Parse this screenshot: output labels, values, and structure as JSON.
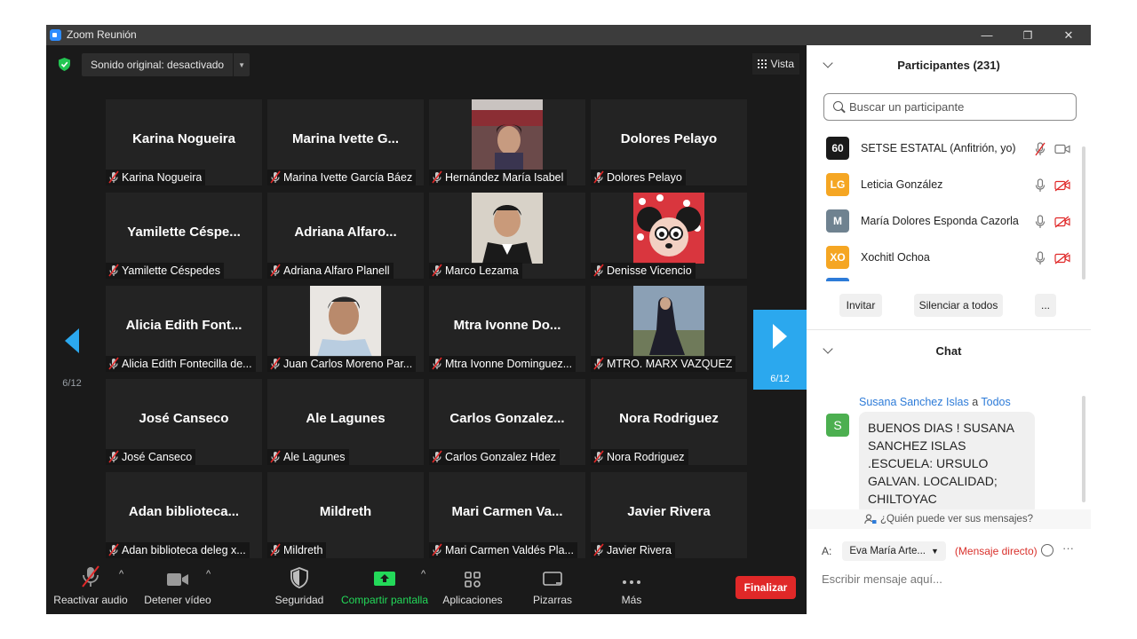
{
  "window": {
    "title": "Zoom Reunión",
    "minimize": "—",
    "restore": "❐",
    "close": "✕"
  },
  "top": {
    "audio_label": "Sonido original: desactivado",
    "view_label": "Vista"
  },
  "paging": {
    "prev_label": "6/12",
    "next_label": "6/12"
  },
  "tiles": [
    {
      "big": "Karina Nogueira",
      "name": "Karina Nogueira",
      "photo": ""
    },
    {
      "big": "Marina Ivette G...",
      "name": "Marina Ivette García Báez",
      "photo": ""
    },
    {
      "big": "",
      "name": "Hernández María Isabel",
      "photo": "woman"
    },
    {
      "big": "Dolores Pelayo",
      "name": "Dolores Pelayo",
      "photo": ""
    },
    {
      "big": "Yamilette  Céspe...",
      "name": "Yamilette Céspedes",
      "photo": ""
    },
    {
      "big": "Adriana  Alfaro...",
      "name": "Adriana Alfaro Planell",
      "photo": ""
    },
    {
      "big": "",
      "name": "Marco Lezama",
      "photo": "man"
    },
    {
      "big": "",
      "name": "Denisse Vicencio",
      "photo": "minnie"
    },
    {
      "big": "Alicia Edith  Font...",
      "name": "Alicia Edith Fontecilla de...",
      "photo": ""
    },
    {
      "big": "",
      "name": "Juan Carlos Moreno Par...",
      "photo": "man2"
    },
    {
      "big": "Mtra  Ivonne  Do...",
      "name": "Mtra Ivonne Dominguez...",
      "photo": ""
    },
    {
      "big": "",
      "name": "MTRO. MARX VAZQUEZ",
      "photo": "dark"
    },
    {
      "big": "José Canseco",
      "name": "José Canseco",
      "photo": ""
    },
    {
      "big": "Ale Lagunes",
      "name": "Ale Lagunes",
      "photo": ""
    },
    {
      "big": "Carlos  Gonzalez...",
      "name": "Carlos Gonzalez Hdez",
      "photo": ""
    },
    {
      "big": "Nora Rodriguez",
      "name": "Nora Rodriguez",
      "photo": ""
    },
    {
      "big": "Adan  biblioteca...",
      "name": "Adan biblioteca deleg x...",
      "photo": ""
    },
    {
      "big": "Mildreth",
      "name": "Mildreth",
      "photo": ""
    },
    {
      "big": "Mari Carmen  Va...",
      "name": "Mari Carmen Valdés Pla...",
      "photo": ""
    },
    {
      "big": "Javier Rivera",
      "name": "Javier Rivera",
      "photo": ""
    }
  ],
  "toolbar": {
    "audio": "Reactivar audio",
    "video": "Detener vídeo",
    "security": "Seguridad",
    "share": "Compartir pantalla",
    "apps": "Aplicaciones",
    "whiteboard": "Pizarras",
    "more": "Más",
    "end": "Finalizar",
    "share_color": "#23d959",
    "end_color": "#e02828"
  },
  "participants": {
    "header": "Participantes (231)",
    "search_placeholder": "Buscar un participante",
    "list": [
      {
        "initials": "60",
        "name": "SETSE ESTATAL (Anfitrión, yo)",
        "color": "#1a1a1a"
      },
      {
        "initials": "LG",
        "name": "Leticia González",
        "color": "#f5a623"
      },
      {
        "initials": "M",
        "name": "María Dolores Esponda Cazorla",
        "color": "#6f8290"
      },
      {
        "initials": "XO",
        "name": "Xochitl Ochoa",
        "color": "#f5a623"
      }
    ],
    "invite": "Invitar",
    "mute_all": "Silenciar a todos",
    "more": "..."
  },
  "chat": {
    "header": "Chat",
    "sender": "Susana Sanchez Islas",
    "to_word": "a",
    "recipient": "Todos",
    "avatar": "S",
    "message": "BUENOS DIAS ! SUSANA SANCHEZ ISLAS .ESCUELA: URSULO GALVAN. LOCALIDAD; CHILTOYAC",
    "who_sees": "¿Quién puede ver sus mensajes?",
    "to_label": "A:",
    "to_value": "Eva María Arte...",
    "direct": "(Mensaje directo)",
    "input_placeholder": "Escribir mensaje aquí..."
  }
}
